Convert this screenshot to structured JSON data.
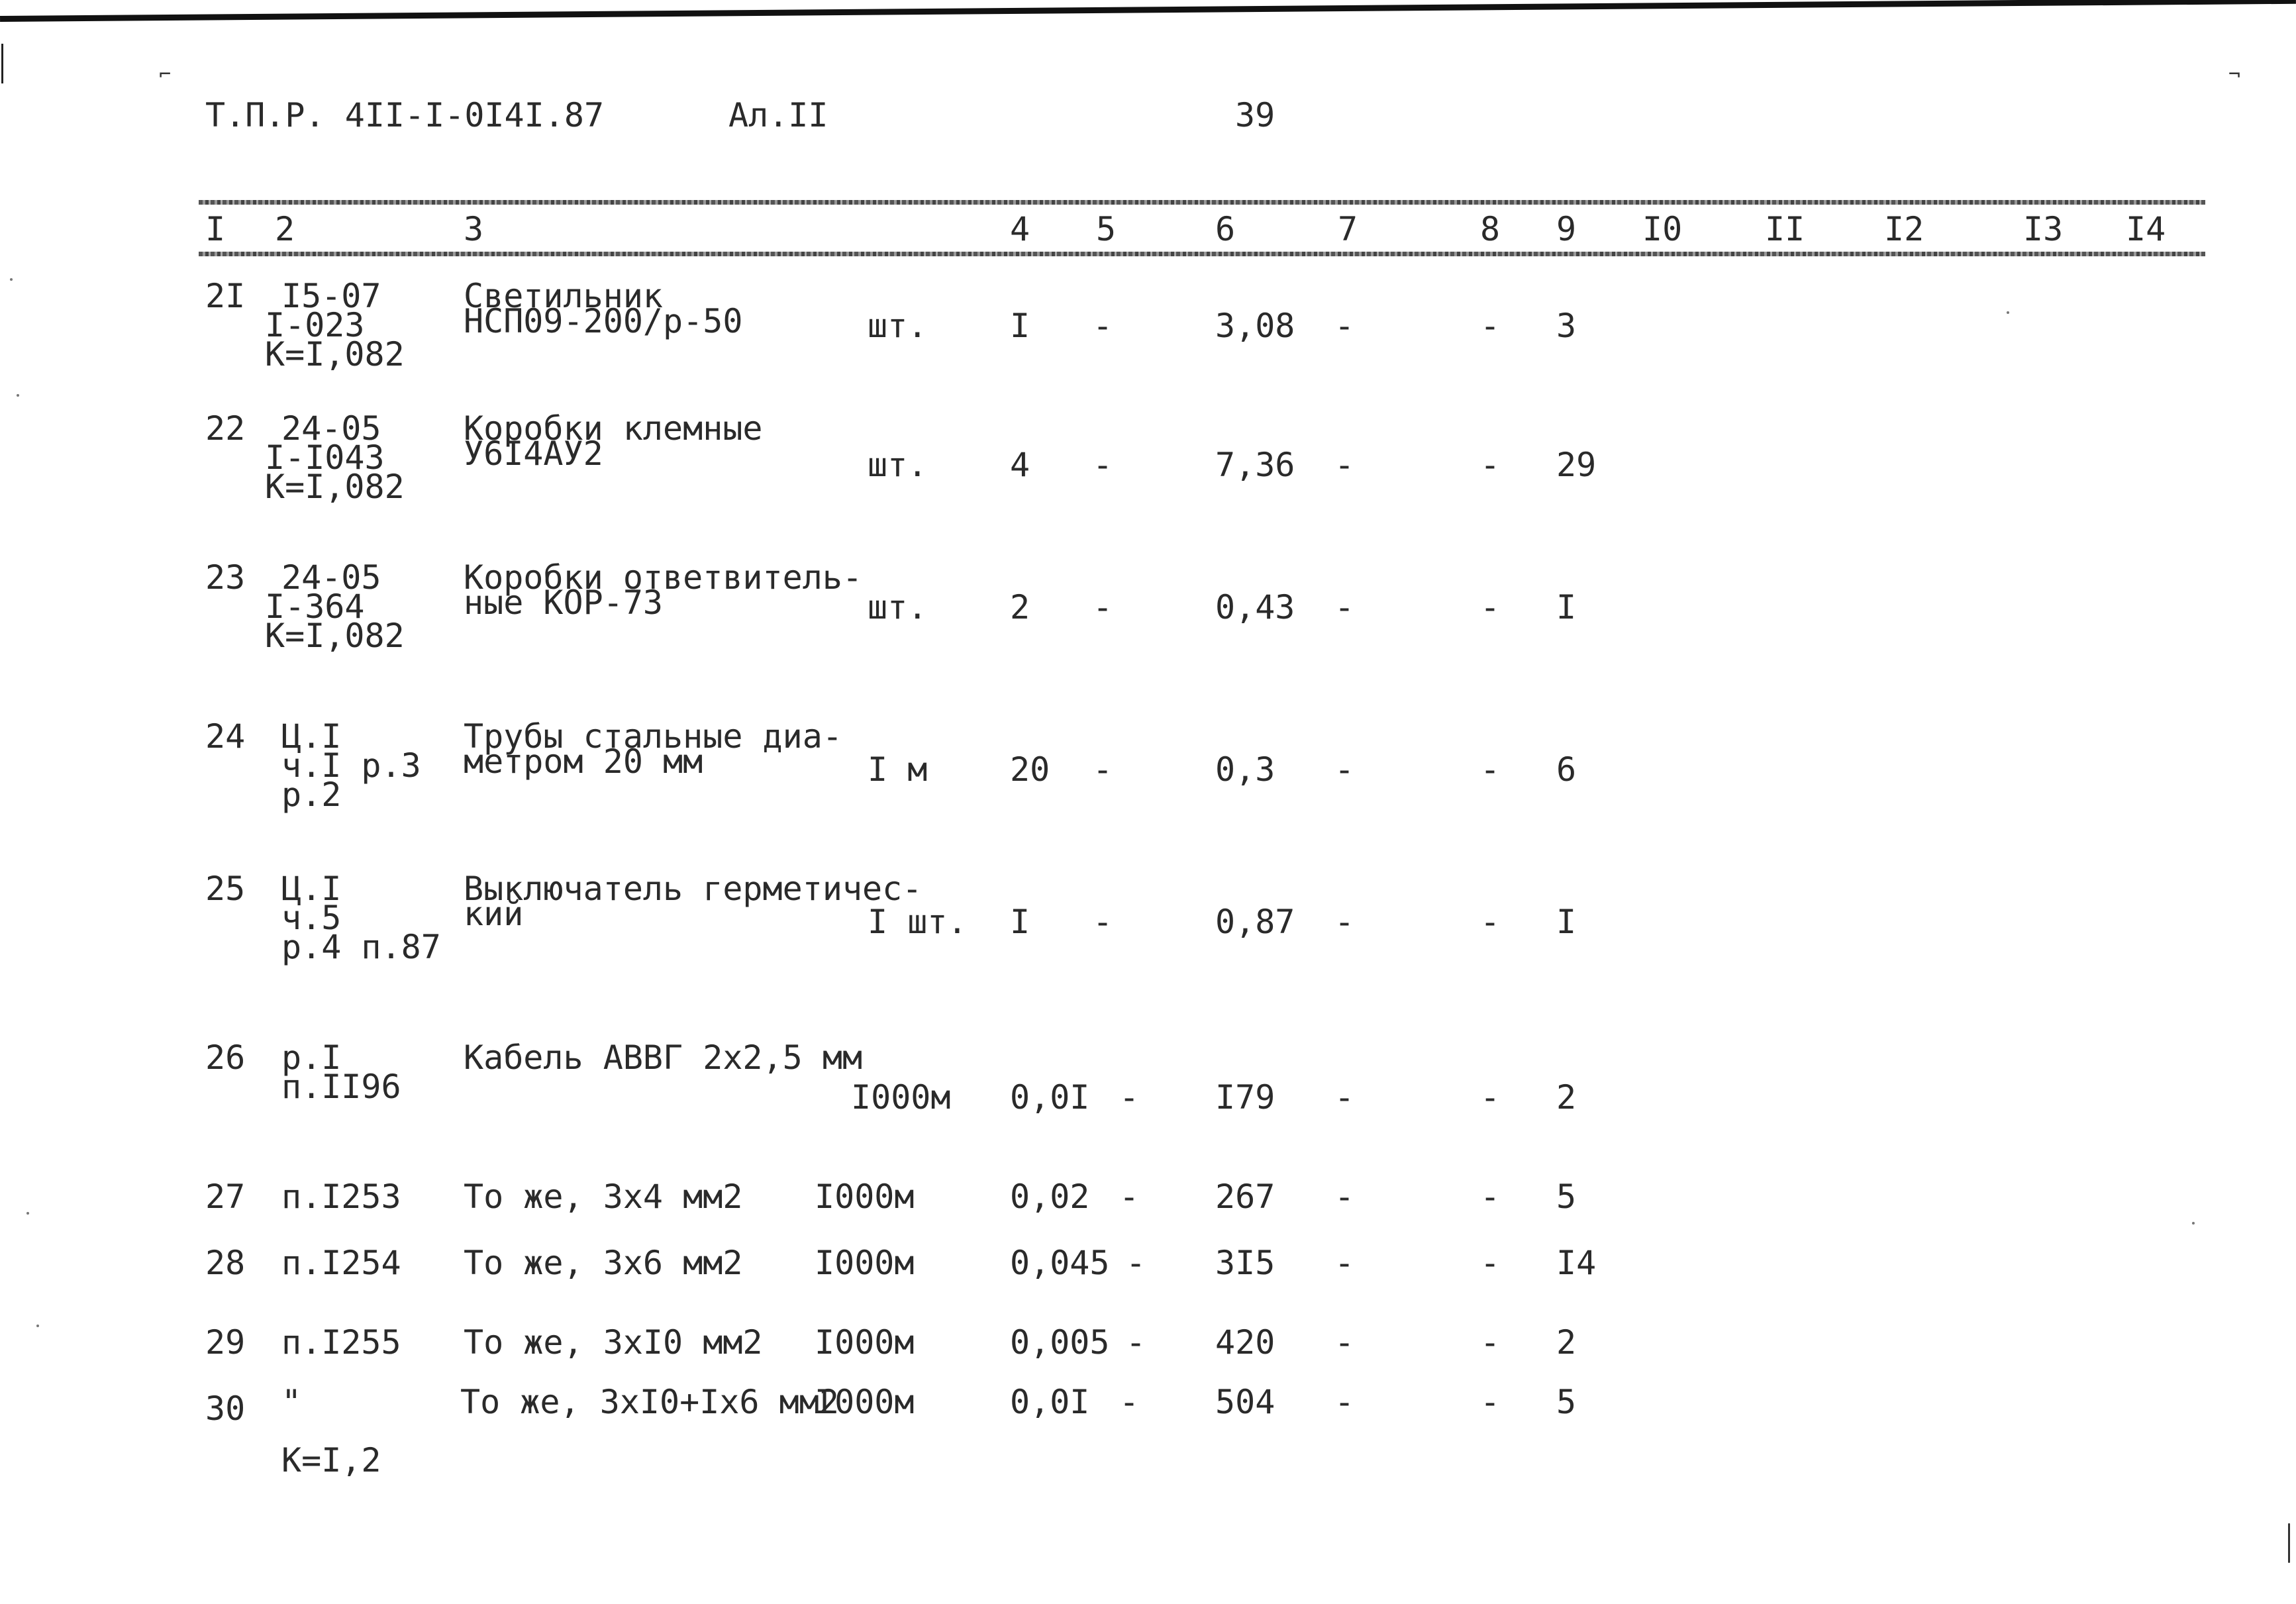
{
  "header": {
    "doc_code": "Т.П.Р. 4II-I-0I4I.87",
    "album": "Ал.II",
    "page_number": "39"
  },
  "columns": [
    "I",
    "2",
    "3",
    "4",
    "5",
    "6",
    "7",
    "8",
    "9",
    "I0",
    "II",
    "I2",
    "I3",
    "I4"
  ],
  "rows": [
    {
      "num": "2I",
      "ref": [
        "I5-07",
        "I-023",
        "К=I,082"
      ],
      "name": [
        "Светильник",
        "НСП09-200/р-50"
      ],
      "unit": "шт.",
      "c4": "I",
      "c5": "-",
      "c6": "3,08",
      "c7": "-",
      "c8": "-",
      "c9": "3"
    },
    {
      "num": "22",
      "ref": [
        "24-05",
        "I-I043",
        "К=I,082"
      ],
      "name": [
        "Коробки клемные",
        "У6I4АУ2"
      ],
      "unit": "шт.",
      "c4": "4",
      "c5": "-",
      "c6": "7,36",
      "c7": "-",
      "c8": "-",
      "c9": "29"
    },
    {
      "num": "23",
      "ref": [
        "24-05",
        "I-364",
        "К=I,082"
      ],
      "name": [
        "Коробки ответвитель-",
        "ные КОР-73"
      ],
      "unit": "шт.",
      "c4": "2",
      "c5": "-",
      "c6": "0,43",
      "c7": "-",
      "c8": "-",
      "c9": "I"
    },
    {
      "num": "24",
      "ref": [
        "Ц.I",
        "ч.I р.3",
        "р.2"
      ],
      "name": [
        "Трубы стальные диа-",
        "метром 20 мм"
      ],
      "unit": "I м",
      "c4": "20",
      "c5": "-",
      "c6": "0,3",
      "c7": "-",
      "c8": "-",
      "c9": "6"
    },
    {
      "num": "25",
      "ref": [
        "Ц.I",
        "ч.5",
        "р.4 п.87"
      ],
      "name": [
        "Выключатель герметичес-",
        "кий"
      ],
      "unit": "I шт.",
      "c4": "I",
      "c5": "-",
      "c6": "0,87",
      "c7": "-",
      "c8": "-",
      "c9": "I"
    },
    {
      "num": "26",
      "ref": [
        "р.I",
        "п.II96"
      ],
      "name": [
        "Кабель АВВГ 2х2,5 мм"
      ],
      "unit": "I000м",
      "c4": "0,0I",
      "c5": "-",
      "c6": "I79",
      "c7": "-",
      "c8": "-",
      "c9": "2"
    },
    {
      "num": "27",
      "ref": [
        "п.I253"
      ],
      "name": [
        "То же, 3х4 мм2"
      ],
      "unit": "I000м",
      "c4": "0,02",
      "c5": "-",
      "c6": "267",
      "c7": "-",
      "c8": "-",
      "c9": "5"
    },
    {
      "num": "28",
      "ref": [
        "п.I254"
      ],
      "name": [
        "То же, 3х6 мм2"
      ],
      "unit": "I000м",
      "c4": "0,045",
      "c5": "-",
      "c6": "3I5",
      "c7": "-",
      "c8": "-",
      "c9": "I4"
    },
    {
      "num": "29",
      "ref": [
        "п.I255"
      ],
      "name": [
        "То же, 3хI0 мм2"
      ],
      "unit": "I000м",
      "c4": "0,005",
      "c5": "-",
      "c6": "420",
      "c7": "-",
      "c8": "-",
      "c9": "2"
    },
    {
      "num": "30",
      "ref": [
        "\"",
        "",
        "К=I,2"
      ],
      "name": [
        "То же, 3хI0+Iх6 мм2"
      ],
      "unit": "I000м",
      "c4": "0,0I",
      "c5": "-",
      "c6": "504",
      "c7": "-",
      "c8": "-",
      "c9": "5"
    }
  ]
}
